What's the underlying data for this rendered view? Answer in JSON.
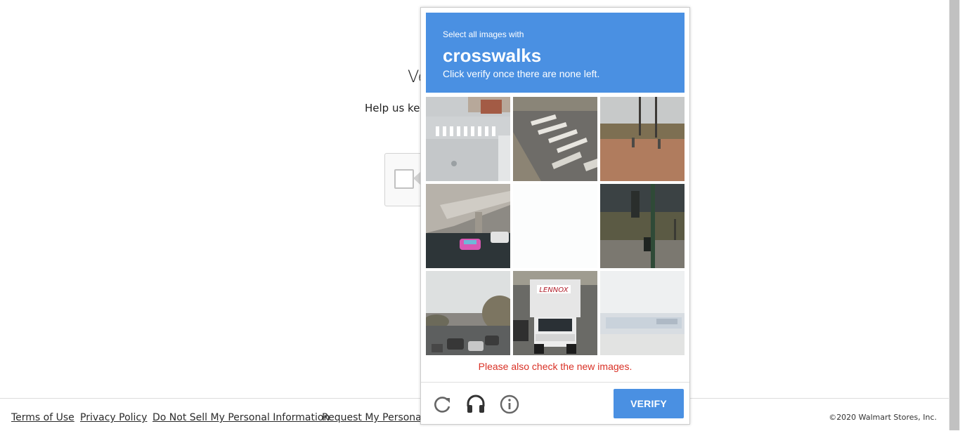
{
  "background": {
    "title": "Ve",
    "subtitle": "Help us kee"
  },
  "footer": {
    "links": [
      "Terms of Use",
      "Privacy Policy",
      "Do Not Sell My Personal Information",
      "Request My Personal In"
    ],
    "copyright": "©2020 Walmart Stores, Inc."
  },
  "challenge": {
    "instruction": "Select all images with",
    "keyword": "crosswalks",
    "hint": "Click verify once there are none left.",
    "tiles": [
      "crosswalk-street",
      "crosswalk-road-corner",
      "desert-roadside",
      "overpass-road",
      "blank-loading",
      "traffic-light-field",
      "highway-traffic",
      "lennox-truck",
      "faded-building"
    ],
    "error_message": "Please also check the new images.",
    "verify_label": "VERIFY",
    "icons": [
      "reload-icon",
      "audio-icon",
      "info-icon"
    ],
    "accent_color": "#4a90e2",
    "error_color": "#d93025"
  }
}
